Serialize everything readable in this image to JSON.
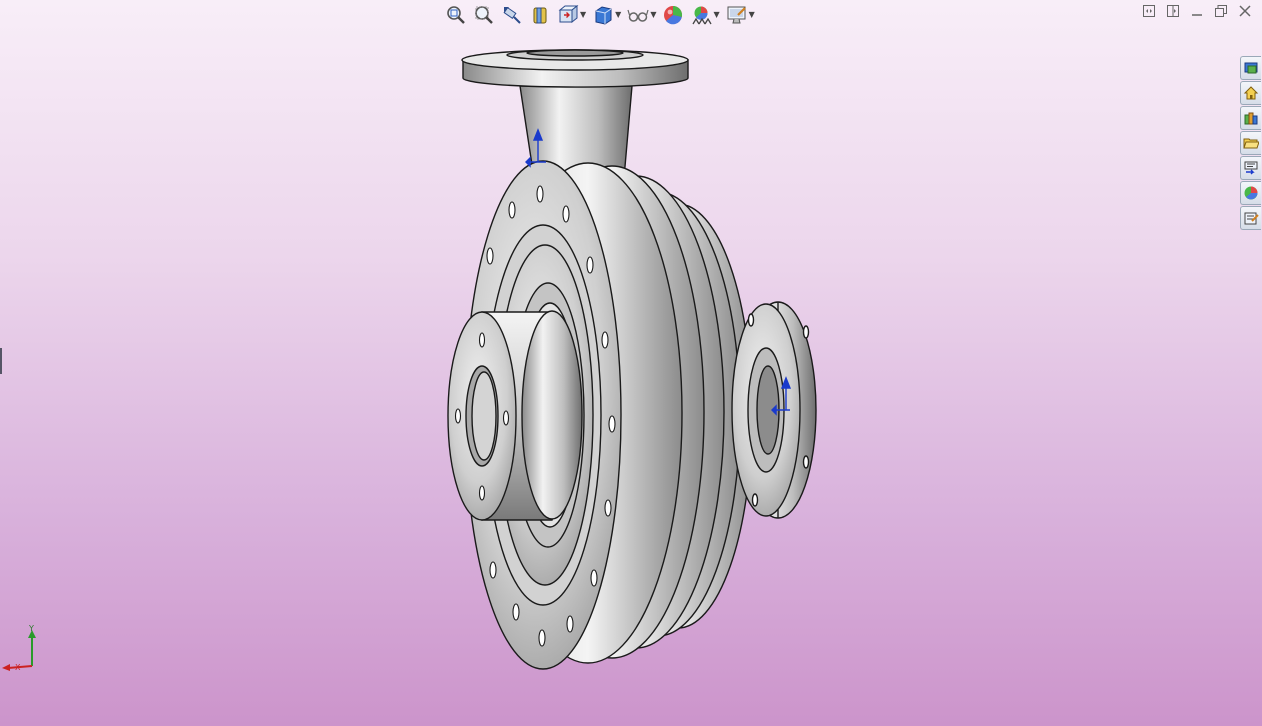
{
  "toolbar": {
    "buttons": [
      {
        "name": "zoom-to-fit-icon",
        "dropdown": false
      },
      {
        "name": "zoom-to-area-icon",
        "dropdown": false
      },
      {
        "name": "previous-view-icon",
        "dropdown": false
      },
      {
        "name": "section-view-icon",
        "dropdown": false
      },
      {
        "name": "view-orientation-icon",
        "dropdown": true
      },
      {
        "name": "display-style-icon",
        "dropdown": true
      },
      {
        "name": "hide-show-items-icon",
        "dropdown": true
      },
      {
        "name": "edit-appearance-icon",
        "dropdown": false
      },
      {
        "name": "apply-scene-icon",
        "dropdown": true
      },
      {
        "name": "view-settings-icon",
        "dropdown": true
      }
    ]
  },
  "window_controls": [
    "tile-horizontal",
    "tile-vertical",
    "minimize",
    "restore",
    "close"
  ],
  "task_pane": {
    "tabs": [
      "solidworks-resources",
      "design-library",
      "file-explorer",
      "view-palette",
      "appearances-scenes",
      "custom-properties"
    ]
  },
  "triad": {
    "y_label": "Y",
    "x_label": "X"
  },
  "colors": {
    "accent_blue": "#1a3acc",
    "triad_green": "#2a9a2a",
    "triad_red": "#cc2222"
  }
}
